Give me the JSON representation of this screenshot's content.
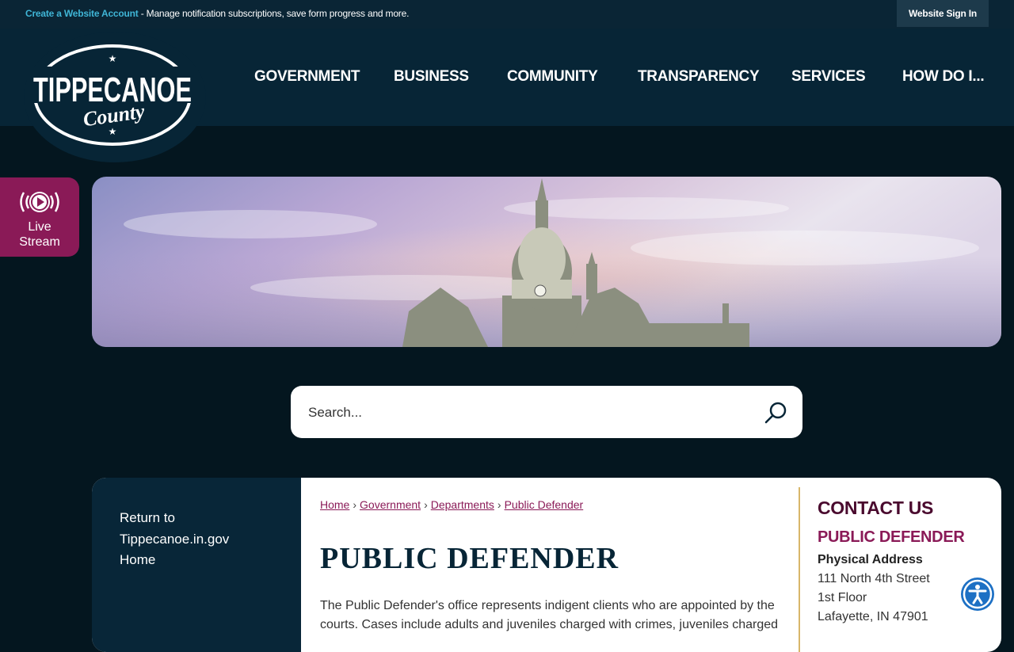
{
  "topbar": {
    "create_account_link": "Create a Website Account",
    "create_account_text": " - Manage notification subscriptions, save form progress and more.",
    "sign_in": "Website Sign In"
  },
  "logo": {
    "line1": "TIPPECANOE",
    "line2": "County"
  },
  "nav": {
    "items": [
      "GOVERNMENT",
      "BUSINESS",
      "COMMUNITY",
      "TRANSPARENCY",
      "SERVICES",
      "HOW DO I..."
    ]
  },
  "live_stream": {
    "label_line1": "Live",
    "label_line2": "Stream",
    "icon": "play-broadcast-icon"
  },
  "search": {
    "placeholder": "Search...",
    "icon": "search-icon"
  },
  "sidebar": {
    "return_line1": "Return to",
    "return_line2": "Tippecanoe.in.gov",
    "return_line3": "Home"
  },
  "breadcrumb": [
    "Home",
    "Government",
    "Departments",
    "Public Defender"
  ],
  "page": {
    "title": "PUBLIC DEFENDER",
    "description": "The Public Defender's office represents indigent clients who are appointed by the courts. Cases include adults and juveniles charged with crimes, juveniles charged"
  },
  "contact": {
    "heading": "CONTACT US",
    "department": "PUBLIC DEFENDER",
    "address_label": "Physical Address",
    "address_lines": [
      "111 North 4th Street",
      "1st Floor",
      "Lafayette, IN 47901"
    ]
  },
  "colors": {
    "navy": "#072536",
    "accent_magenta": "#8a1a57",
    "link_cyan": "#3fb5d6",
    "divider_gold": "#d8b66a"
  }
}
